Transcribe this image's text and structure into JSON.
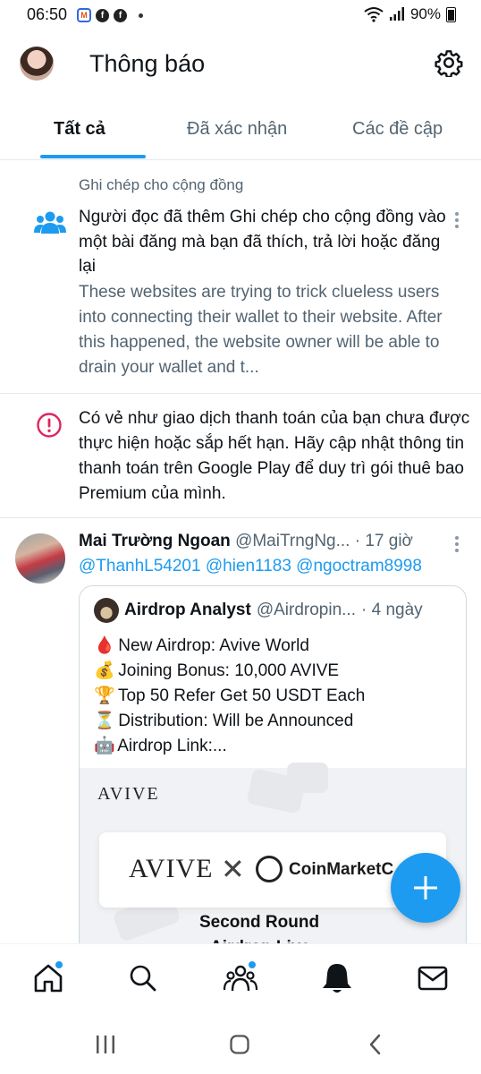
{
  "status_bar": {
    "time": "06:50",
    "battery": "90%",
    "app_badges": [
      "M",
      "f",
      "f"
    ]
  },
  "header": {
    "title": "Thông báo"
  },
  "tabs": [
    {
      "label": "Tất cả",
      "active": true
    },
    {
      "label": "Đã xác nhận",
      "active": false
    },
    {
      "label": "Các đề cập",
      "active": false
    }
  ],
  "notifications": {
    "community": {
      "kicker": "Ghi chép cho cộng đồng",
      "body": "Người đọc đã thêm Ghi chép cho cộng đồng vào một bài đăng mà bạn đã thích, trả lời hoặc đăng lại",
      "quote": "These websites are trying to trick clueless users into connecting their wallet to their website. After this happened, the website owner will be able to drain your wallet and t..."
    },
    "payment": {
      "body": "Có vẻ như giao dịch thanh toán của bạn chưa được thực hiện hoặc sắp hết hạn. Hãy cập nhật thông tin thanh toán trên Google Play để duy trì gói thuê bao Premium của mình."
    },
    "post": {
      "author_name": "Mai Trường Ngoan",
      "handle": "@MaiTrngNg...",
      "time": "· 17 giờ",
      "mentions": "@ThanhL54201 @hien1183 @ngoctram8998",
      "quoted": {
        "author_name": "Airdrop Analyst",
        "handle": "@Airdropin...",
        "time": "· 4 ngày",
        "lines": [
          {
            "emoji": "🩸",
            "text": "New Airdrop: Avive World"
          },
          {
            "emoji": "💰",
            "text": "Joining Bonus: 10,000 AVIVE"
          },
          {
            "emoji": "🏆",
            "text": "Top 50 Refer Get 50 USDT Each"
          },
          {
            "emoji": "⏳",
            "text": "Distribution: Will be Announced"
          },
          {
            "emoji": "🤖",
            "text": "Airdrop Link:..."
          }
        ],
        "image": {
          "logo_small": "AVIVE",
          "logo_large": "AVIVE",
          "cross": "✕",
          "partner": "CoinMarketC",
          "line1": "Second Round",
          "line2": "Airdrop Live"
        }
      }
    }
  },
  "bottom_nav": [
    "home",
    "search",
    "communities",
    "notifications",
    "messages"
  ],
  "colors": {
    "accent": "#1d9bf0",
    "text": "#0f1419",
    "muted": "#536471",
    "alert": "#e0245e"
  }
}
